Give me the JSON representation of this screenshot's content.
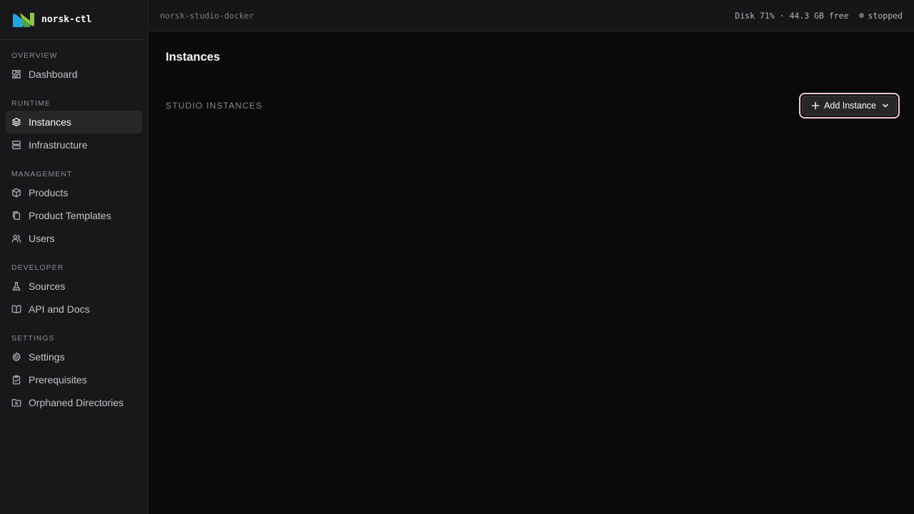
{
  "brand": {
    "name": "norsk-ctl"
  },
  "topbar": {
    "host": "norsk-studio-docker",
    "disk": "Disk 71% · 44.3 GB free",
    "status": "stopped"
  },
  "sidebar": {
    "sections": [
      {
        "label": "OVERVIEW",
        "items": [
          {
            "label": "Dashboard",
            "icon": "dashboard-icon"
          }
        ]
      },
      {
        "label": "RUNTIME",
        "items": [
          {
            "label": "Instances",
            "icon": "layers-icon",
            "active": true
          },
          {
            "label": "Infrastructure",
            "icon": "server-icon"
          }
        ]
      },
      {
        "label": "MANAGEMENT",
        "items": [
          {
            "label": "Products",
            "icon": "package-icon"
          },
          {
            "label": "Product Templates",
            "icon": "copy-icon"
          },
          {
            "label": "Users",
            "icon": "users-icon"
          }
        ]
      },
      {
        "label": "DEVELOPER",
        "items": [
          {
            "label": "Sources",
            "icon": "flask-icon"
          },
          {
            "label": "API and Docs",
            "icon": "book-icon"
          }
        ]
      },
      {
        "label": "SETTINGS",
        "items": [
          {
            "label": "Settings",
            "icon": "gear-icon"
          },
          {
            "label": "Prerequisites",
            "icon": "clipboard-check-icon"
          },
          {
            "label": "Orphaned Directories",
            "icon": "folder-x-icon"
          }
        ]
      }
    ]
  },
  "main": {
    "title": "Instances",
    "section_heading": "STUDIO INSTANCES",
    "add_button_label": "Add Instance"
  }
}
